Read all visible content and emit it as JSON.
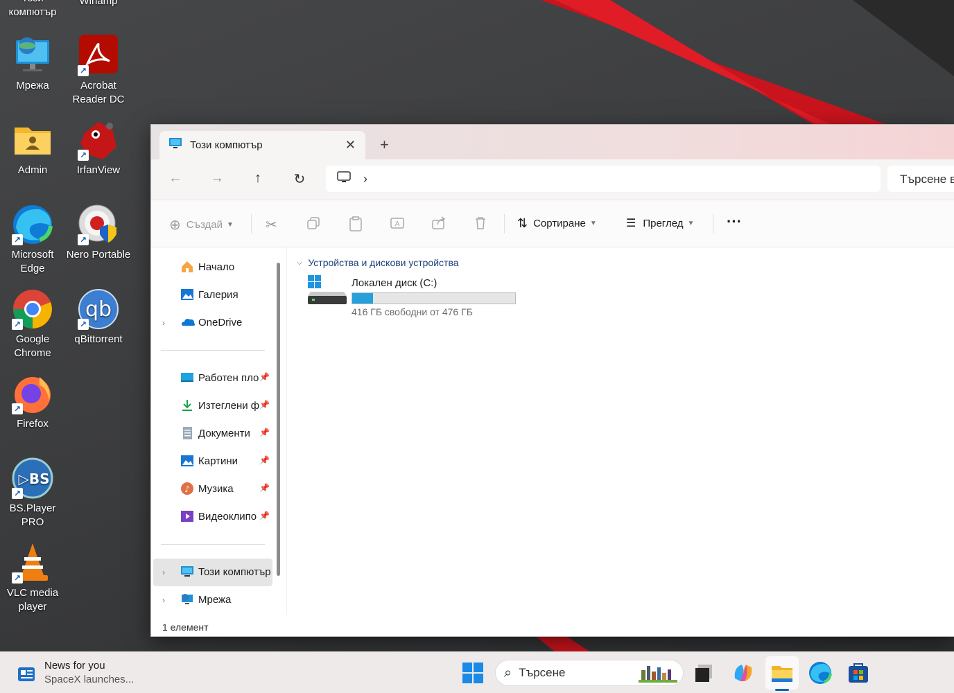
{
  "desktop": {
    "top_labels": [
      {
        "label": "Този\nкомпютър"
      },
      {
        "label": "Winamp"
      }
    ],
    "icons": [
      {
        "label": "Мрежа"
      },
      {
        "label": "Acrobat Reader DC"
      },
      {
        "label": "Admin"
      },
      {
        "label": "IrfanView"
      },
      {
        "label": "Microsoft Edge"
      },
      {
        "label": "Nero Portable"
      },
      {
        "label": "Google Chrome"
      },
      {
        "label": "qBittorrent"
      },
      {
        "label": "Firefox"
      },
      {
        "label": "BS.Player PRO"
      },
      {
        "label": "VLC media player"
      }
    ]
  },
  "explorer": {
    "tab_title": "Този компютър",
    "new_tab": "+",
    "search_placeholder": "Търсене в",
    "toolbar": {
      "create_label": "Създай",
      "sort_label": "Сортиране",
      "view_label": "Преглед",
      "more_label": "···"
    },
    "sidebar": {
      "home": "Начало",
      "gallery": "Галерия",
      "onedrive": "OneDrive",
      "desktop": "Работен пло",
      "downloads": "Изтеглени ф",
      "documents": "Документи",
      "pictures": "Картини",
      "music": "Музика",
      "videos": "Видеоклипо",
      "this_pc": "Този компютър",
      "network": "Мрежа"
    },
    "main": {
      "group_header": "Устройства и дискови устройства",
      "drive_name": "Локален диск (C:)",
      "drive_free": "416 ГБ свободни от 476 ГБ",
      "drive_used_fraction": 0.126
    },
    "status": "1 елемент"
  },
  "taskbar": {
    "news_title": "News for you",
    "news_sub": "SpaceX launches...",
    "search_label": "Търсене"
  }
}
